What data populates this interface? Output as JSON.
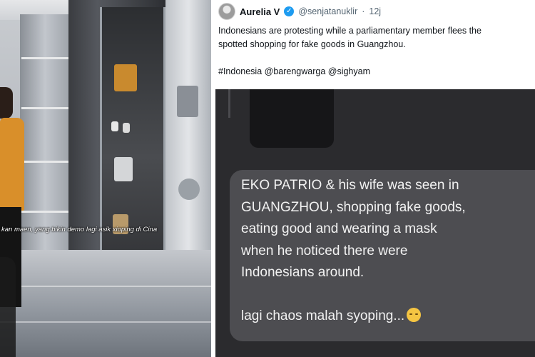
{
  "photo": {
    "caption": "kan maen, yang bikin demo lagi asik xioping di Cina"
  },
  "tweet": {
    "author_name": "Aurelia V",
    "handle": "@senjatanuklir",
    "separator": "·",
    "time": "12j",
    "text_lines": [
      "Indonesians are protesting while a parliamentary member flees the",
      "spotted shopping for fake goods in Guangzhou."
    ],
    "hashtags_line": "#Indonesia @barengwarga @sighyam"
  },
  "chat_screenshot": {
    "message_lines": [
      "EKO PATRIO & his wife was seen in",
      "GUANGZHOU, shopping fake goods,",
      "eating good and wearing a mask",
      "when he noticed there were",
      "Indonesians around."
    ],
    "message_tail": "lagi chaos malah syoping...",
    "emoji": "pensive-face-emoji"
  },
  "colors": {
    "verified_badge": "#1d9bf0",
    "chat_bubble": "#4d4d51",
    "chat_background": "#2b2b2e",
    "jacket": "#d98f2a"
  }
}
